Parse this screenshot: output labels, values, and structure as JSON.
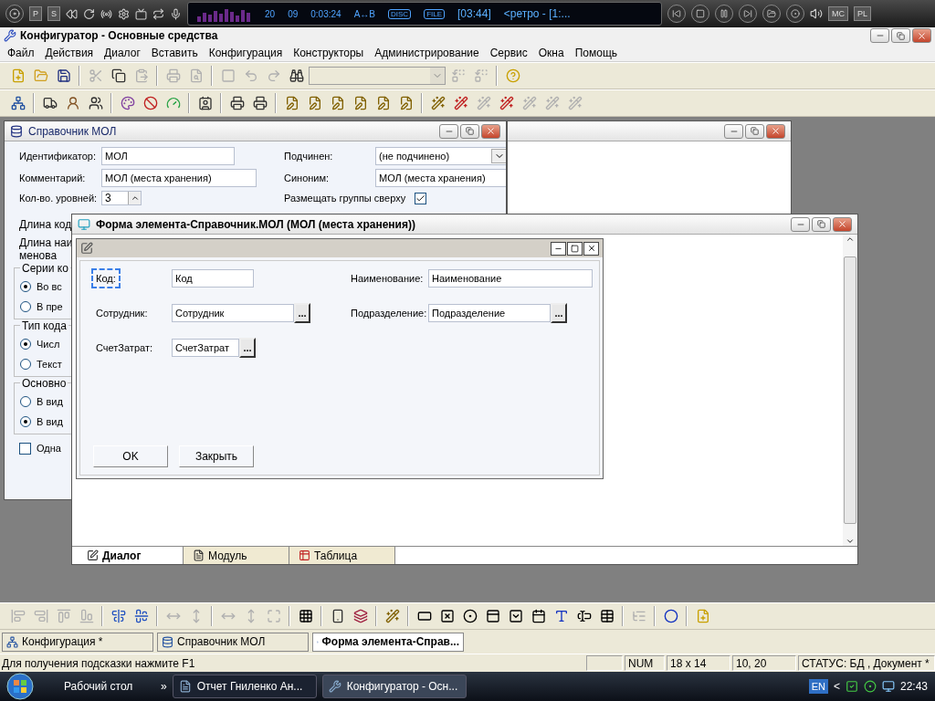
{
  "media_player": {
    "buttons": [
      "P",
      "S"
    ],
    "display": {
      "track": "20",
      "sub": "09",
      "elapsed": "0:03:24",
      "ab": "A↔B",
      "disc": "DISC",
      "file": "FILE",
      "total": "[03:44]",
      "title": "<ретро - [1:..."
    },
    "right_buttons": [
      "MC",
      "PL"
    ]
  },
  "window": {
    "title": "Конфигуратор - Основные средства"
  },
  "menu": [
    "Файл",
    "Действия",
    "Диалог",
    "Вставить",
    "Конфигурация",
    "Конструкторы",
    "Администрирование",
    "Сервис",
    "Окна",
    "Помощь"
  ],
  "toolbar_1": [
    {
      "kind": "button",
      "disabled": false
    },
    {
      "kind": "button",
      "disabled": false
    },
    {
      "kind": "button",
      "disabled": false
    },
    {
      "kind": "separator"
    },
    {
      "kind": "button",
      "disabled": true
    },
    {
      "kind": "button",
      "disabled": false
    },
    {
      "kind": "button",
      "disabled": true
    },
    {
      "kind": "separator"
    },
    {
      "kind": "button",
      "disabled": true
    },
    {
      "kind": "button",
      "disabled": true
    },
    {
      "kind": "separator"
    },
    {
      "kind": "button",
      "disabled": true
    },
    {
      "kind": "button",
      "disabled": true
    },
    {
      "kind": "button",
      "disabled": true
    },
    {
      "kind": "button",
      "disabled": false
    },
    {
      "kind": "combo",
      "disabled": true
    },
    {
      "kind": "button",
      "disabled": true
    },
    {
      "kind": "button",
      "disabled": true
    },
    {
      "kind": "separator"
    },
    {
      "kind": "button",
      "disabled": false
    }
  ],
  "toolbar_2": [
    {
      "kind": "button",
      "disabled": false
    },
    {
      "kind": "separator"
    },
    {
      "kind": "button",
      "disabled": false
    },
    {
      "kind": "button",
      "disabled": false
    },
    {
      "kind": "button",
      "disabled": false
    },
    {
      "kind": "separator"
    },
    {
      "kind": "button",
      "disabled": false
    },
    {
      "kind": "button",
      "disabled": false
    },
    {
      "kind": "button",
      "disabled": false
    },
    {
      "kind": "separator"
    },
    {
      "kind": "button",
      "disabled": false
    },
    {
      "kind": "separator"
    },
    {
      "kind": "button",
      "disabled": false
    },
    {
      "kind": "button",
      "disabled": false
    },
    {
      "kind": "separator"
    },
    {
      "kind": "button",
      "disabled": false
    },
    {
      "kind": "button",
      "disabled": false
    },
    {
      "kind": "button",
      "disabled": false
    },
    {
      "kind": "button",
      "disabled": false
    },
    {
      "kind": "button",
      "disabled": false
    },
    {
      "kind": "button",
      "disabled": false
    },
    {
      "kind": "separator"
    },
    {
      "kind": "button",
      "disabled": false
    },
    {
      "kind": "button",
      "disabled": false
    },
    {
      "kind": "button",
      "disabled": true
    },
    {
      "kind": "button",
      "disabled": false
    },
    {
      "kind": "button",
      "disabled": true
    },
    {
      "kind": "button",
      "disabled": true
    },
    {
      "kind": "button",
      "disabled": true
    }
  ],
  "catalog_window": {
    "title": "Справочник МОЛ",
    "fields": [
      {
        "label": "Идентификатор:",
        "value": "МОЛ"
      },
      {
        "label": "Подчинен:",
        "value": "(не подчинено)",
        "kind": "dropdown"
      },
      {
        "label": "Комментарий:",
        "value": "МОЛ (места хранения)"
      },
      {
        "label": "Синоним:",
        "value": "МОЛ (места хранения)"
      }
    ],
    "levels": {
      "label": "Кол-во. уровней:",
      "value": "3"
    },
    "groups_on_top": {
      "label": "Размещать группы сверху",
      "checked": true
    },
    "cut_items": [
      {
        "kind": "label",
        "text": "Длина код"
      },
      {
        "kind": "label",
        "text": "Длина наименова"
      },
      {
        "kind": "group",
        "title": "Серии ко",
        "options": [
          {
            "label": "Во вс",
            "selected": true
          },
          {
            "label": "В пре",
            "selected": false
          }
        ]
      },
      {
        "kind": "group",
        "title": "Тип кода",
        "options": [
          {
            "label": "Числ",
            "selected": true
          },
          {
            "label": "Текст",
            "selected": false
          }
        ]
      },
      {
        "kind": "group",
        "title": "Основно",
        "options": [
          {
            "label": "В вид",
            "selected": false
          },
          {
            "label": "В вид",
            "selected": true
          }
        ]
      },
      {
        "kind": "checkbox",
        "text": "Одна",
        "checked": false
      }
    ]
  },
  "form_window": {
    "title": "Форма элемента-Справочник.МОЛ (МОЛ (места хранения))",
    "controls": [
      {
        "label": "Код:",
        "value": "Код",
        "has_button": false,
        "selected": true
      },
      {
        "label": "Наименование:",
        "value": "Наименование",
        "has_button": false,
        "selected": false
      },
      {
        "label": "Сотрудник:",
        "value": "Сотрудник",
        "has_button": true,
        "selected": false
      },
      {
        "label": "Подразделение:",
        "value": "Подразделение",
        "has_button": true,
        "selected": false
      },
      {
        "label": "СчетЗатрат:",
        "value": "СчетЗатрат",
        "has_button": true,
        "selected": false
      }
    ],
    "button_text": "...",
    "buttons": [
      "OK",
      "Закрыть"
    ],
    "tabs": [
      {
        "label": "Диалог",
        "selected": true
      },
      {
        "label": "Модуль",
        "selected": false
      },
      {
        "label": "Таблица",
        "selected": false
      }
    ]
  },
  "toolbar_3": [
    {
      "kind": "button",
      "disabled": true
    },
    {
      "kind": "button",
      "disabled": true
    },
    {
      "kind": "button",
      "disabled": true
    },
    {
      "kind": "button",
      "disabled": true
    },
    {
      "kind": "separator"
    },
    {
      "kind": "button",
      "disabled": false
    },
    {
      "kind": "button",
      "disabled": false
    },
    {
      "kind": "separator"
    },
    {
      "kind": "button",
      "disabled": true
    },
    {
      "kind": "button",
      "disabled": true
    },
    {
      "kind": "separator"
    },
    {
      "kind": "button",
      "disabled": true
    },
    {
      "kind": "button",
      "disabled": true
    },
    {
      "kind": "button",
      "disabled": true
    },
    {
      "kind": "separator"
    },
    {
      "kind": "button",
      "disabled": false
    },
    {
      "kind": "separator"
    },
    {
      "kind": "button",
      "disabled": false
    },
    {
      "kind": "button",
      "disabled": false
    },
    {
      "kind": "separator"
    },
    {
      "kind": "button",
      "disabled": false
    },
    {
      "kind": "separator"
    },
    {
      "kind": "button",
      "disabled": false
    },
    {
      "kind": "button",
      "disabled": false
    },
    {
      "kind": "button",
      "disabled": false
    },
    {
      "kind": "button",
      "disabled": false
    },
    {
      "kind": "button",
      "disabled": false
    },
    {
      "kind": "button",
      "disabled": false
    },
    {
      "kind": "button",
      "disabled": false
    },
    {
      "kind": "button",
      "disabled": false
    },
    {
      "kind": "button",
      "disabled": false
    },
    {
      "kind": "separator"
    },
    {
      "kind": "button",
      "disabled": true
    },
    {
      "kind": "separator"
    },
    {
      "kind": "button",
      "disabled": false
    },
    {
      "kind": "separator"
    },
    {
      "kind": "button",
      "disabled": false
    }
  ],
  "window_tabs": [
    {
      "label": "Конфигурация *",
      "selected": false
    },
    {
      "label": "Справочник МОЛ",
      "selected": false
    },
    {
      "label": "Форма элемента-Справ...",
      "selected": true
    }
  ],
  "status_bar": {
    "hint": "Для получения подсказки нажмите F1",
    "panes": [
      "NUM",
      "18 x 14",
      "10, 20",
      "СТАТУС: БД , Документ *"
    ]
  },
  "taskbar": {
    "desktop": "Рабочий стол",
    "more": "»",
    "items": [
      {
        "label": "Отчет Гниленко Ан...",
        "selected": false
      },
      {
        "label": "Конфигуратор - Осн...",
        "selected": true
      }
    ],
    "language": "EN",
    "tray_toggle": "<",
    "clock": "22:43"
  }
}
